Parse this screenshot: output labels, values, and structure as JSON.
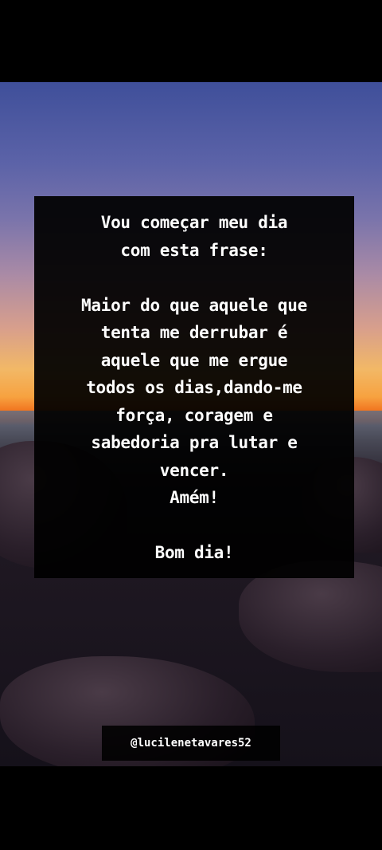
{
  "quote": {
    "intro": [
      "Vou começar meu dia",
      "com esta frase:"
    ],
    "body": [
      "Maior do que aquele que",
      "tenta me derrubar é",
      "aquele que me ergue",
      "todos os dias,dando-me",
      "força, coragem e",
      "sabedoria pra lutar e",
      "vencer.",
      "Amém!"
    ],
    "closing": "Bom dia!"
  },
  "watermark": {
    "handle": "@lucilenetavares52"
  },
  "colors": {
    "background": "#000000",
    "text": "#ffffff",
    "box": "#000000",
    "sunset_orange": "#f06a18",
    "sky_blue": "#3f4f9a"
  }
}
